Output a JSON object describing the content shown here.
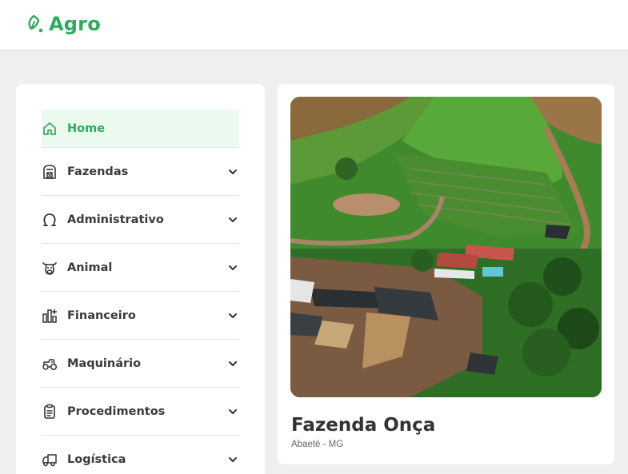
{
  "app": {
    "brand": "Agro",
    "brand_color": "#2eab5e"
  },
  "sidebar": {
    "items": [
      {
        "label": "Home",
        "icon": "home-icon",
        "active": true,
        "expandable": false
      },
      {
        "label": "Fazendas",
        "icon": "farm-building-icon",
        "active": false,
        "expandable": true
      },
      {
        "label": "Administrativo",
        "icon": "horseshoe-icon",
        "active": false,
        "expandable": true
      },
      {
        "label": "Animal",
        "icon": "cow-icon",
        "active": false,
        "expandable": true
      },
      {
        "label": "Financeiro",
        "icon": "bar-chart-icon",
        "active": false,
        "expandable": true
      },
      {
        "label": "Maquinário",
        "icon": "tractor-icon",
        "active": false,
        "expandable": true
      },
      {
        "label": "Procedimentos",
        "icon": "clipboard-icon",
        "active": false,
        "expandable": true
      },
      {
        "label": "Logística",
        "icon": "truck-icon",
        "active": false,
        "expandable": true
      }
    ]
  },
  "farm": {
    "name": "Fazenda Onça",
    "location": "Abaeté - MG"
  }
}
